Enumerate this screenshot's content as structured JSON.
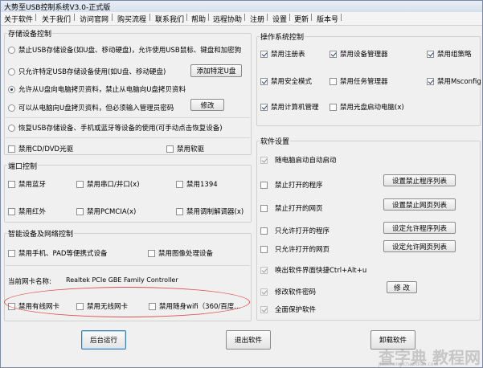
{
  "window": {
    "title": "大势至USB控制系统V3.0-正式版"
  },
  "menu": [
    "关于软件",
    "关于我们",
    "访问官网",
    "购买流程",
    "联系我们",
    "帮助",
    "远程协助",
    "注册",
    "设置",
    "更新",
    "版本号"
  ],
  "storage": {
    "title": "存储设备控制",
    "opt1": "禁止USB存储设备(如U盘、移动硬盘)，允许使用USB鼠标、键盘和加密狗",
    "opt2": "只允许特定USB存储设备使用(如U盘、移动硬盘)",
    "opt2_button": "添加特定U盘",
    "opt3": "允许从U盘向电脑拷贝资料，禁止从电脑向U盘拷贝资料",
    "opt4": "可以从电脑向U盘拷贝资料，但必须输入管理员密码",
    "opt4_button": "修改",
    "opt5": "恢复USB存储设备、手机或蓝牙等设备的使用(可手动点击恢复设备)",
    "cd": "禁用CD/DVD光驱",
    "floppy": "禁用软驱"
  },
  "ports": {
    "title": "端口控制",
    "bluetooth": "禁用蓝牙",
    "serial": "禁用串口/并口(x)",
    "p1394": "禁用1394",
    "infrared": "禁用红外",
    "pcmcia": "禁用PCMCIA(x)",
    "modem": "禁用调制解调器(x)"
  },
  "smart": {
    "title": "智能设备及网络控制",
    "phone": "禁用手机、PAD等便携式设备",
    "imaging": "禁用图像处理设备",
    "nic_label": "当前网卡名称:",
    "nic_value": "Realtek PCIe GBE Family Controller",
    "wired": "禁用有线网卡",
    "wireless": "禁用无线网卡",
    "portable_wifi": "禁用随身wifi（360/百度..."
  },
  "os": {
    "title": "操作系统控制",
    "registry": "禁用注册表",
    "device_manager": "禁用设备管理器",
    "group_policy": "禁用组策略",
    "safe_mode": "禁用安全模式",
    "task_manager": "禁用任务管理器",
    "msconfig": "禁用Msconfig",
    "computer_mgmt": "禁用计算机管理",
    "cd_boot": "禁用光盘启动电脑(x)"
  },
  "software": {
    "title": "软件设置",
    "autostart": "随电脑启动自动启动",
    "block_program": "禁止打开的程序",
    "block_program_btn": "设置禁止程序列表",
    "block_web": "禁止打开的网页",
    "block_web_btn": "设置禁止网页列表",
    "allow_program": "只允许打开的程序",
    "allow_program_btn": "设定允许程序列表",
    "allow_web": "只允许打开的网页",
    "allow_web_btn": "设定允许网页列表",
    "hotkey": "唤出软件界面快捷Ctrl+Alt+u",
    "password": "修改软件密码",
    "password_btn": "修 改",
    "full_protect": "全面保护软件"
  },
  "bottom": {
    "background": "后台运行",
    "exit": "退出软件",
    "uninstall": "卸载软件"
  },
  "watermark": {
    "text": "查字典 教程网",
    "sub": "jiaocheng.chazidian.com"
  },
  "colors": {
    "highlight_ellipse": "#e05050",
    "title_gradient_top": "#e8eef6"
  }
}
